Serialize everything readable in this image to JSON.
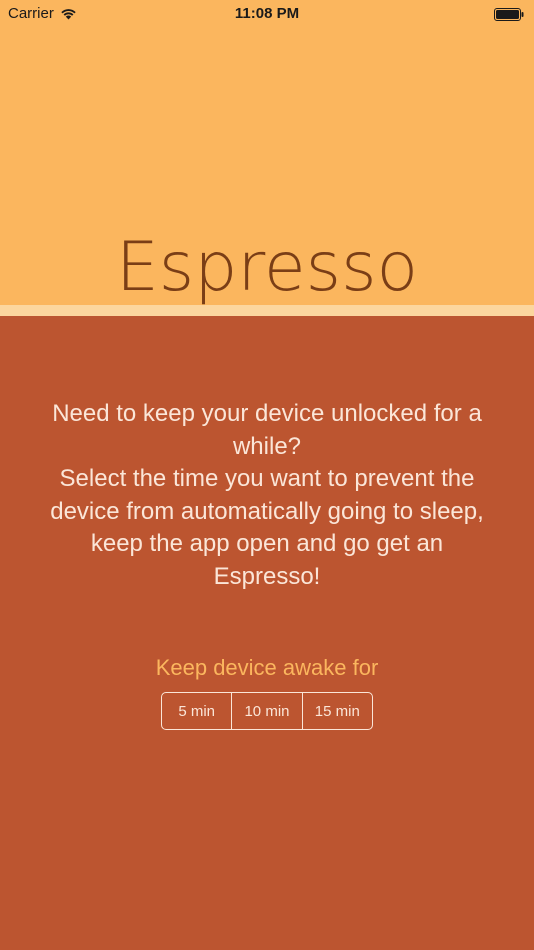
{
  "status_bar": {
    "carrier": "Carrier",
    "time": "11:08 PM",
    "wifi_icon": "wifi-icon",
    "battery_icon": "battery-icon"
  },
  "app": {
    "title": "Espresso"
  },
  "description": {
    "lines": [
      "Need to keep your device unlocked for a",
      "while?",
      "Select the time you want to prevent the",
      "device from automatically going to sleep,",
      "keep the app open and go get an",
      "Espresso!"
    ]
  },
  "timer": {
    "label": "Keep device awake for",
    "options": [
      "5 min",
      "10 min",
      "15 min"
    ]
  },
  "colors": {
    "header_bg": "#FBB65E",
    "divider": "#FCD69E",
    "body_bg": "#BC5530",
    "title_text": "#7A3E16",
    "body_text": "#FBE6D8",
    "accent_label": "#FBB65E"
  }
}
